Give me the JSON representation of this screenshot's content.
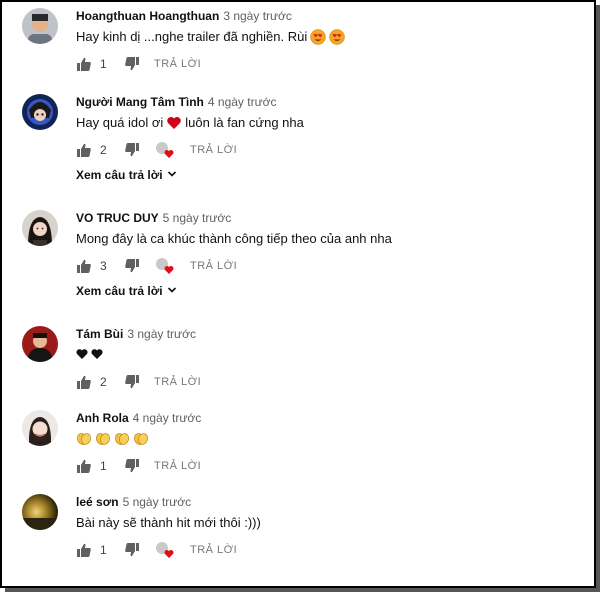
{
  "comments": [
    {
      "author": "Hoangthuan Hoangthuan",
      "time": "3 ngày trước",
      "text": "Hay kinh dị ...nghe trailer đã nghiền. Rùi",
      "emojis": [
        "heart-eyes-emoji",
        "heart-eyes-emoji"
      ],
      "likes": "1",
      "reply_label": "TRẢ LỜI"
    },
    {
      "author": "Người Mang Tâm Tình",
      "time": "4 ngày trước",
      "text_before": "Hay quá idol ơi",
      "text_after": "luôn là fan cứng nha",
      "emojis": [
        "red-heart-emoji"
      ],
      "likes": "2",
      "reply_label": "TRẢ LỜI",
      "view_replies": "Xem câu trả lời"
    },
    {
      "author": "VO TRUC DUY",
      "time": "5 ngày trước",
      "text": "Mong đây là ca khúc thành công tiếp theo của anh nha",
      "likes": "3",
      "reply_label": "TRẢ LỜI",
      "view_replies": "Xem câu trả lời"
    },
    {
      "author": "Tám Bùi",
      "time": "3 ngày trước",
      "emojis": [
        "black-heart-emoji",
        "black-heart-emoji"
      ],
      "likes": "2",
      "reply_label": "TRẢ LỜI"
    },
    {
      "author": "Anh Rola",
      "time": "4 ngày trước",
      "emojis": [
        "clapping-hands-emoji",
        "clapping-hands-emoji",
        "clapping-hands-emoji",
        "clapping-hands-emoji"
      ],
      "likes": "1",
      "reply_label": "TRẢ LỜI"
    },
    {
      "author": "leé sơn",
      "time": "5 ngày trước",
      "text": "Bài này sẽ thành hit mới thôi :)))",
      "likes": "1",
      "reply_label": "TRẢ LỜI"
    }
  ],
  "icons": {
    "like": "thumbs-up-icon",
    "dislike": "thumbs-down-icon",
    "creator_heart": "creator-heart-icon",
    "expand": "chevron-down-icon"
  }
}
